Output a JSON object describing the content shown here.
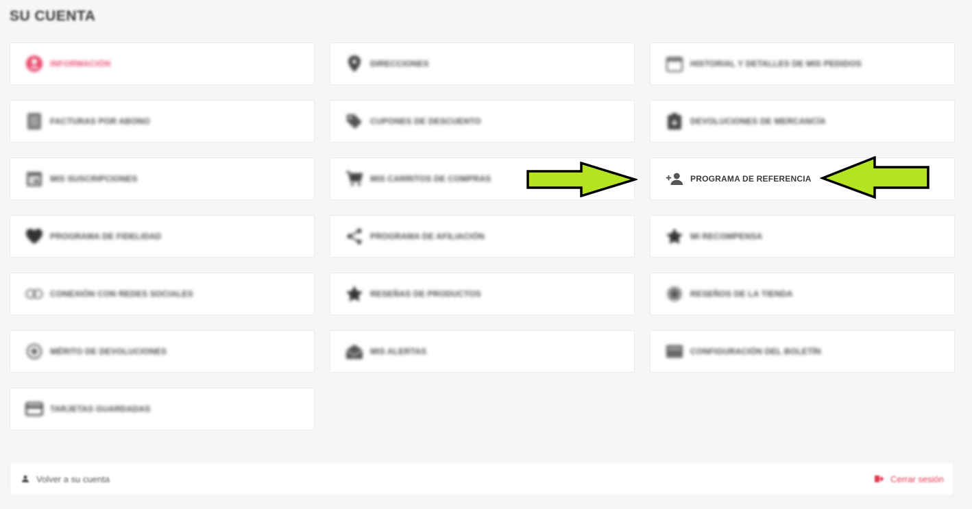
{
  "page": {
    "title": "SU CUENTA"
  },
  "tiles": [
    {
      "label": "INFORMACIÓN",
      "icon": "user-circle-icon"
    },
    {
      "label": "DIRECCIONES",
      "icon": "location-pin-icon"
    },
    {
      "label": "HISTORIAL Y DETALLES DE MIS PEDIDOS",
      "icon": "calendar-icon"
    },
    {
      "label": "FACTURAS POR ABONO",
      "icon": "document-icon"
    },
    {
      "label": "CUPONES DE DESCUENTO",
      "icon": "tag-icon"
    },
    {
      "label": "DEVOLUCIONES DE MERCANCÍA",
      "icon": "return-box-icon"
    },
    {
      "label": "MIS SUSCRIPCIONES",
      "icon": "calendar-check-icon"
    },
    {
      "label": "MIS CARRITOS DE COMPRAS",
      "icon": "cart-icon"
    },
    {
      "label": "PROGRAMA DE REFERENCIA",
      "icon": "add-user-icon"
    },
    {
      "label": "PROGRAMA DE FIDELIDAD",
      "icon": "heart-icon"
    },
    {
      "label": "PROGRAMA DE AFILIACIÓN",
      "icon": "share-icon"
    },
    {
      "label": "MI RECOMPENSA",
      "icon": "star-icon"
    },
    {
      "label": "CONEXIÓN CON REDES SOCIALES",
      "icon": "link-icon"
    },
    {
      "label": "RESEÑAS DE PRODUCTOS",
      "icon": "star-icon"
    },
    {
      "label": "RESEÑOS DE LA TIENDA",
      "icon": "star-badge-icon"
    },
    {
      "label": "MÉRITO DE DEVOLUCIONES",
      "icon": "refund-icon"
    },
    {
      "label": "MIS ALERTAS",
      "icon": "envelope-open-icon"
    },
    {
      "label": "CONFIGURACIÓN DEL BOLETÍN",
      "icon": "newsletter-icon"
    },
    {
      "label": "TARJETAS GUARDADAS",
      "icon": "credit-card-icon"
    }
  ],
  "footer": {
    "back_label": "Volver a su cuenta",
    "logout_label": "Cerrar sesión"
  },
  "colors": {
    "accent": "#e84c6e",
    "arrow": "#b5e31f"
  }
}
